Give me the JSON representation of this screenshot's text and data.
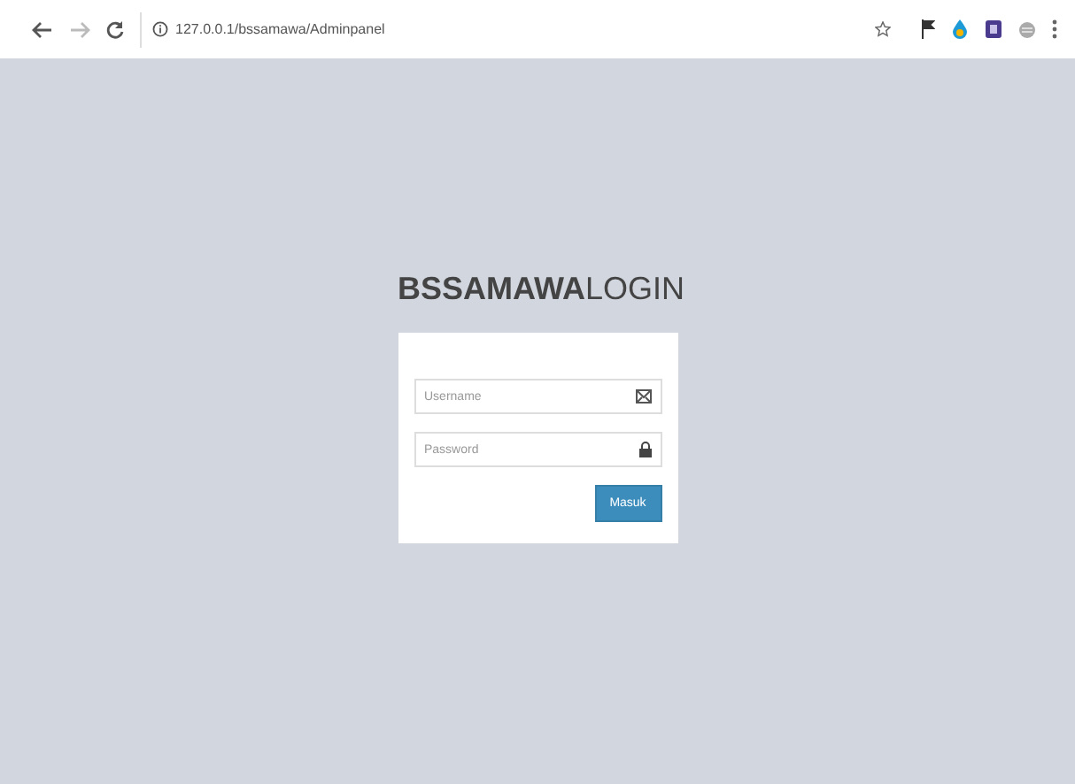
{
  "browser": {
    "url": "127.0.0.1/bssamawa/Adminpanel"
  },
  "login": {
    "title": "**BSSAMAWA**LOGIN",
    "username": {
      "placeholder": "Username"
    },
    "password": {
      "placeholder": "Password"
    },
    "submit": "Masuk"
  }
}
